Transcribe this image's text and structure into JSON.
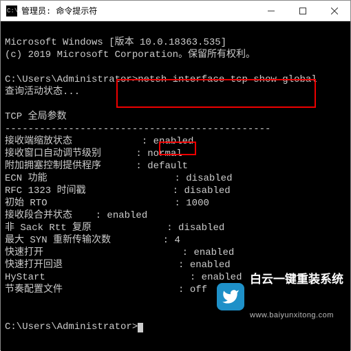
{
  "titlebar": {
    "icon_text": "C:\\.",
    "title": "管理员: 命令提示符"
  },
  "terminal": {
    "banner1": "Microsoft Windows [版本 10.0.18363.535]",
    "banner2": "(c) 2019 Microsoft Corporation。保留所有权利。",
    "prompt_path": "C:\\Users\\Administrator>",
    "command": "netsh interface tcp show global",
    "querying": "查询活动状态...",
    "section_title": "TCP 全局参数",
    "divider": "----------------------------------------------",
    "rows": [
      {
        "label": "接收端缩放状态",
        "sep": ": ",
        "value": "enabled"
      },
      {
        "label": "接收窗口自动调节级别",
        "sep": ": ",
        "value": "normal"
      },
      {
        "label": "附加拥塞控制提供程序",
        "sep": ": ",
        "value": "default"
      },
      {
        "label": "ECN 功能",
        "sep": ": ",
        "value": "disabled"
      },
      {
        "label": "RFC 1323 时间戳",
        "sep": ": ",
        "value": "disabled"
      },
      {
        "label": "初始 RTO",
        "sep": ": ",
        "value": "1000"
      },
      {
        "label": "接收段合并状态",
        "sep": ": ",
        "value": "enabled"
      },
      {
        "label": "非 Sack Rtt 复原",
        "sep": ": ",
        "value": "disabled"
      },
      {
        "label": "最大 SYN 重新传输次数",
        "sep": ": ",
        "value": "4"
      },
      {
        "label": "快速打开",
        "sep": ": ",
        "value": "enabled"
      },
      {
        "label": "快速打开回退",
        "sep": ": ",
        "value": "enabled"
      },
      {
        "label": "HyStart",
        "sep": ": ",
        "value": "enabled"
      },
      {
        "label": "节奏配置文件",
        "sep": ": ",
        "value": "off"
      }
    ],
    "prompt2": "C:\\Users\\Administrator>"
  },
  "watermark": {
    "line1": "白云一键重装系统",
    "line2": "www.baiyunxitong.com"
  }
}
